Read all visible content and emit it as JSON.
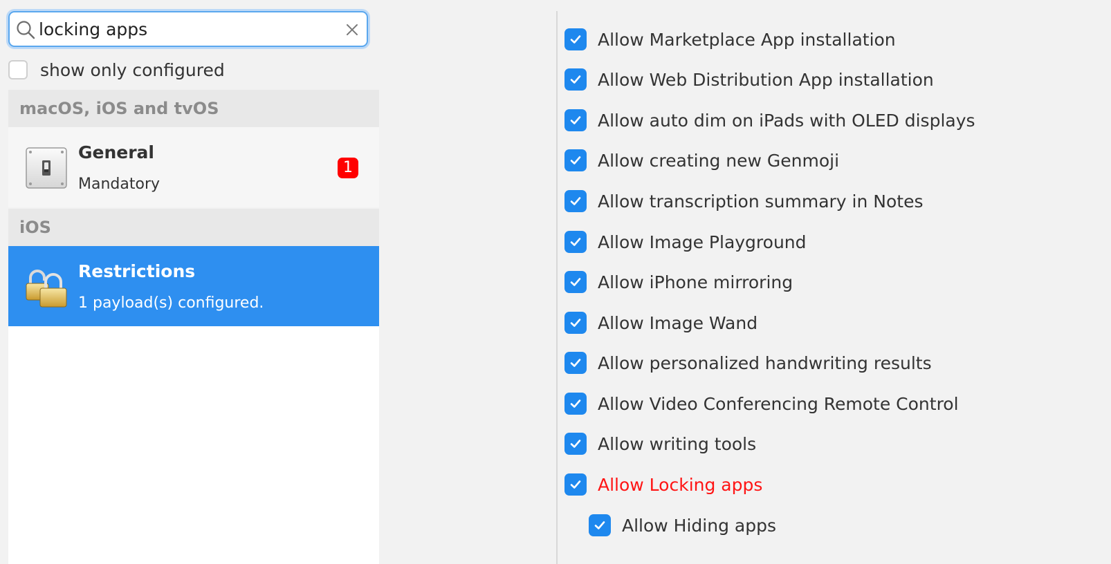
{
  "search": {
    "value": "locking apps",
    "placeholder": ""
  },
  "filter": {
    "label": "show only configured",
    "checked": false
  },
  "groups": [
    {
      "header": "macOS, iOS and tvOS"
    },
    {
      "header": "iOS"
    }
  ],
  "payloads": {
    "general": {
      "title": "General",
      "subtitle": "Mandatory",
      "badge": "1",
      "icon": "switch-icon"
    },
    "restrictions": {
      "title": "Restrictions",
      "subtitle": "1 payload(s) configured.",
      "icon": "padlocks-icon"
    }
  },
  "options": [
    {
      "label": "Allow Marketplace App installation",
      "checked": true
    },
    {
      "label": "Allow Web Distribution App installation",
      "checked": true
    },
    {
      "label": "Allow auto dim on iPads with OLED displays",
      "checked": true
    },
    {
      "label": "Allow creating new Genmoji",
      "checked": true
    },
    {
      "label": "Allow transcription summary in Notes",
      "checked": true
    },
    {
      "label": "Allow Image Playground",
      "checked": true
    },
    {
      "label": "Allow iPhone mirroring",
      "checked": true
    },
    {
      "label": "Allow Image Wand",
      "checked": true
    },
    {
      "label": "Allow personalized handwriting results",
      "checked": true
    },
    {
      "label": "Allow Video Conferencing Remote Control",
      "checked": true
    },
    {
      "label": "Allow writing tools",
      "checked": true
    },
    {
      "label": "Allow Locking apps",
      "checked": true,
      "highlighted": true
    },
    {
      "label": "Allow Hiding apps",
      "checked": true,
      "indented": true
    }
  ],
  "colors": {
    "accent": "#2e8ff0",
    "checkbox": "#1e88ee",
    "highlight_text": "#ff1414",
    "badge": "#ff0000"
  }
}
